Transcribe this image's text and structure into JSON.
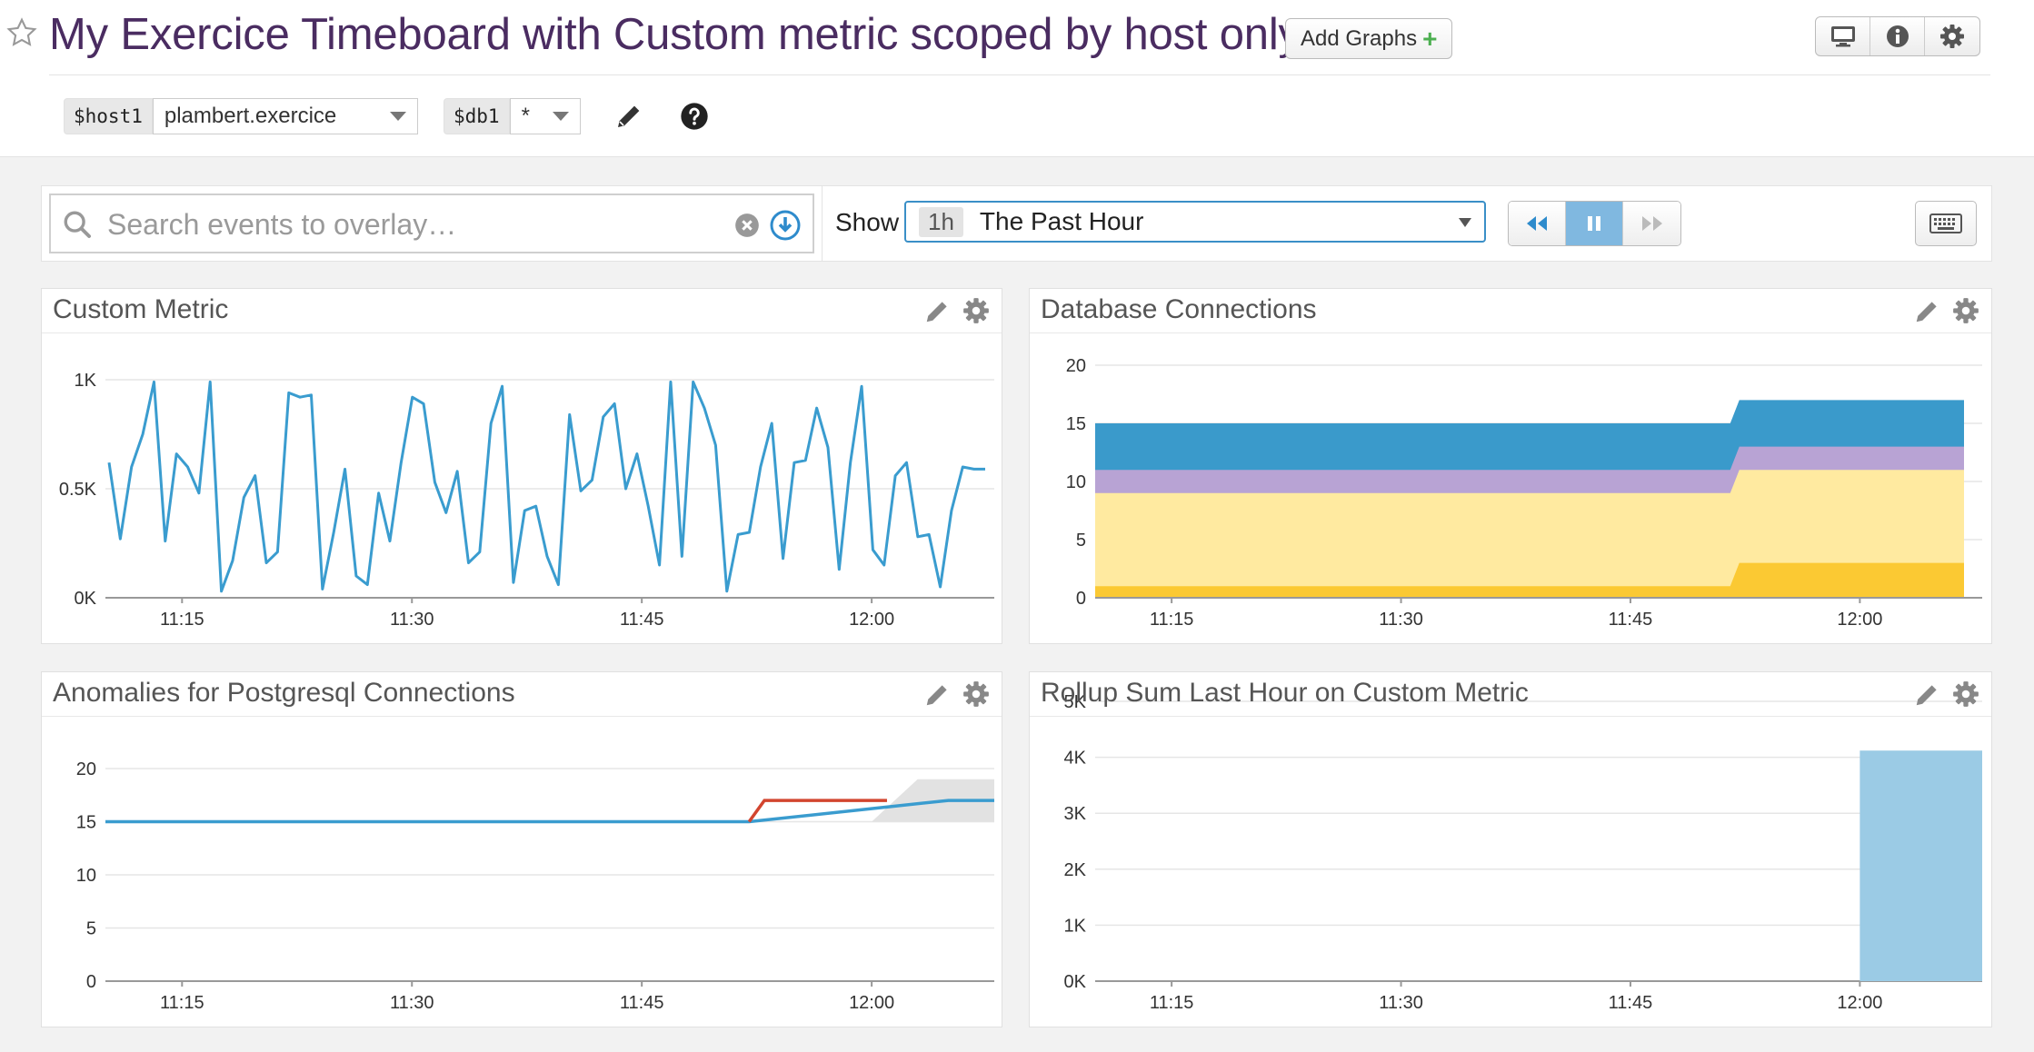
{
  "header": {
    "title": "My Exercice Timeboard with Custom metric scoped by host only",
    "add_graphs_label": "Add Graphs",
    "template_vars": [
      {
        "name": "$host1",
        "value": "plambert.exercice"
      },
      {
        "name": "$db1",
        "value": "*"
      }
    ],
    "tool_icons": [
      "monitor-icon",
      "info-icon",
      "gear-icon"
    ]
  },
  "toolbar": {
    "search_placeholder": "Search events to overlay…",
    "show_label": "Show",
    "timeframe_short": "1h",
    "timeframe_label": "The Past Hour",
    "playback": [
      "rewind-icon",
      "pause-icon",
      "fast-forward-icon"
    ]
  },
  "colors": {
    "title": "#4a2c61",
    "line_blue": "#3a9ccf",
    "anomaly_red": "#d2452f",
    "area_blue": "#3a9acb",
    "area_purple": "#b8a3d4",
    "area_light_yellow": "#ffeaa0",
    "area_yellow": "#fbc933",
    "bar_blue": "#9bcbe5"
  },
  "widgets": [
    {
      "title": "Custom Metric"
    },
    {
      "title": "Database Connections"
    },
    {
      "title": "Anomalies for Postgresql Connections"
    },
    {
      "title": "Rollup Sum Last Hour on Custom Metric"
    }
  ],
  "chart_data": [
    {
      "type": "line",
      "title": "Custom Metric",
      "x_ticks": [
        "11:15",
        "11:30",
        "11:45",
        "12:00"
      ],
      "y_ticks": [
        "0K",
        "0.5K",
        "1K"
      ],
      "ylim": [
        0,
        1000
      ],
      "series": [
        {
          "values": [
            620,
            270,
            600,
            750,
            990,
            260,
            660,
            600,
            480,
            990,
            30,
            170,
            460,
            560,
            160,
            210,
            940,
            920,
            930,
            40,
            300,
            590,
            100,
            60,
            480,
            260,
            620,
            920,
            890,
            530,
            390,
            580,
            160,
            210,
            800,
            970,
            70,
            400,
            420,
            190,
            60,
            840,
            490,
            540,
            830,
            890,
            500,
            660,
            420,
            150,
            990,
            190,
            990,
            870,
            700,
            30,
            290,
            300,
            600,
            800,
            180,
            620,
            630,
            870,
            690,
            130,
            620,
            970,
            220,
            150,
            560,
            620,
            280,
            290,
            50,
            400,
            600,
            590,
            590
          ]
        }
      ]
    },
    {
      "type": "area",
      "title": "Database Connections",
      "x_ticks": [
        "11:15",
        "11:30",
        "11:45",
        "12:00"
      ],
      "y_ticks": [
        "0",
        "5",
        "10",
        "15",
        "20"
      ],
      "ylim": [
        0,
        20
      ],
      "stacked_layers": [
        {
          "color": "area_yellow",
          "before": 1,
          "after": 3
        },
        {
          "color": "area_light_yellow",
          "before": 9,
          "after": 11
        },
        {
          "color": "area_purple",
          "before": 11,
          "after": 13
        },
        {
          "color": "area_blue",
          "before": 15,
          "after": 17
        }
      ],
      "change_time": "11:52"
    },
    {
      "type": "line",
      "title": "Anomalies for Postgresql Connections",
      "x_ticks": [
        "11:15",
        "11:30",
        "11:45",
        "12:00"
      ],
      "y_ticks": [
        "0",
        "5",
        "10",
        "15",
        "20"
      ],
      "ylim": [
        0,
        20
      ],
      "series": [
        {
          "color": "line_blue",
          "points": [
            [
              "11:10",
              15
            ],
            [
              "11:52",
              15
            ],
            [
              "12:05",
              17
            ],
            [
              "12:08",
              17
            ]
          ]
        },
        {
          "color": "anomaly_red",
          "points": [
            [
              "11:52",
              15
            ],
            [
              "11:53",
              17
            ],
            [
              "12:01",
              17
            ]
          ]
        }
      ],
      "bounds": {
        "points": [
          [
            "11:52",
            15,
            15
          ],
          [
            "12:00",
            15,
            15
          ],
          [
            "12:03",
            15,
            19
          ],
          [
            "12:08",
            15,
            19
          ]
        ]
      }
    },
    {
      "type": "bar",
      "title": "Rollup Sum Last Hour on Custom Metric",
      "x_ticks": [
        "11:15",
        "11:30",
        "11:45",
        "12:00"
      ],
      "y_ticks": [
        "0K",
        "1K",
        "2K",
        "3K",
        "4K",
        "5K"
      ],
      "ylim": [
        0,
        5000
      ],
      "bars": [
        {
          "start": "12:00",
          "end": "12:08",
          "value": 4120
        }
      ]
    }
  ]
}
